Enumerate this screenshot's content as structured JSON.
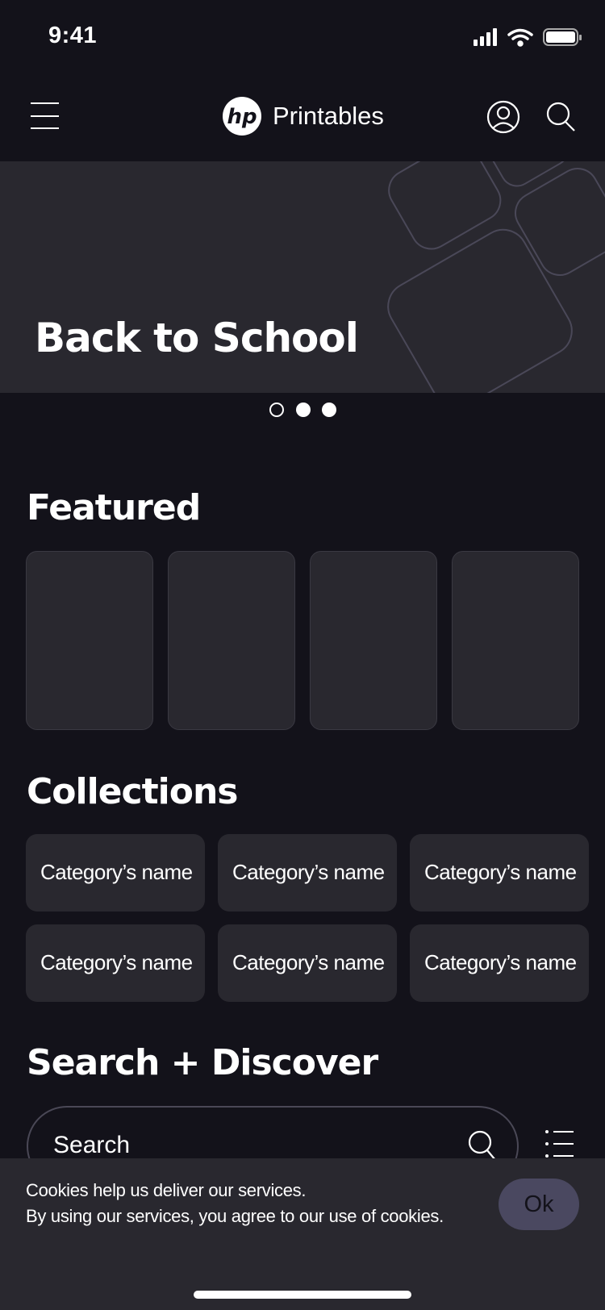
{
  "status_bar": {
    "time": "9:41"
  },
  "header": {
    "brand": "Printables",
    "logo_text": "hp",
    "icons": [
      "menu-icon",
      "user-icon",
      "search-icon"
    ]
  },
  "hero": {
    "title": "Back to School",
    "slides": 3,
    "active_slide": 1
  },
  "featured": {
    "title": "Featured",
    "cards": 4
  },
  "collections": {
    "title": "Collections",
    "items": [
      "Category’s name",
      "Category’s name",
      "Category’s name",
      "Category’s name",
      "Category’s name",
      "Category’s name"
    ]
  },
  "search_discover": {
    "title": "Search + Discover",
    "search_placeholder": "Search"
  },
  "cookie_banner": {
    "line1": "Cookies help us deliver our services.",
    "line2": "By using our services, you agree to our use of cookies.",
    "ok_label": "Ok"
  },
  "colors": {
    "background": "#13121a",
    "surface": "#29282f",
    "accent": "#4a4860"
  }
}
